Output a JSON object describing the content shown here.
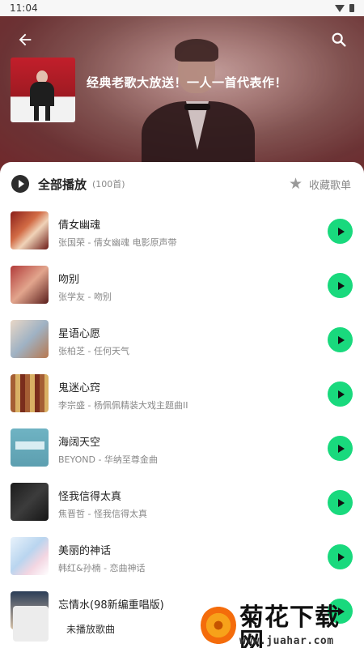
{
  "status_bar": {
    "time": "11:04"
  },
  "header": {
    "title": "经典老歌大放送！一人一首代表作！"
  },
  "toolbar": {
    "play_all_label": "全部播放",
    "count": "(100首)",
    "collect_label": "收藏歌单"
  },
  "songs": [
    {
      "title": "倩女幽魂",
      "subtitle": "张国荣 - 倩女幽魂 电影原声带"
    },
    {
      "title": "吻别",
      "subtitle": "张学友 - 吻别"
    },
    {
      "title": "星语心愿",
      "subtitle": "张柏芝 - 任何天气"
    },
    {
      "title": "鬼迷心窍",
      "subtitle": "李宗盛 - 杨佩佩精装大戏主题曲II"
    },
    {
      "title": "海阔天空",
      "subtitle": "BEYOND - 华纳至尊金曲"
    },
    {
      "title": "怪我信得太真",
      "subtitle": "焦晋哲 - 怪我信得太真"
    },
    {
      "title": "美丽的神话",
      "subtitle": "韩红&孙楠 - 恋曲神话"
    },
    {
      "title": "忘情水(98新编重唱版)",
      "subtitle": ""
    }
  ],
  "mini_player": {
    "label": "未播放歌曲"
  },
  "watermark": {
    "text": "菊花下载网",
    "url": "www.juahar.com"
  },
  "colors": {
    "accent_green": "#19d97d",
    "header_red": "#7a2a2e"
  },
  "icons": {
    "back": "arrow-left-icon",
    "search": "search-icon",
    "play": "play-icon",
    "star": "star-icon"
  }
}
